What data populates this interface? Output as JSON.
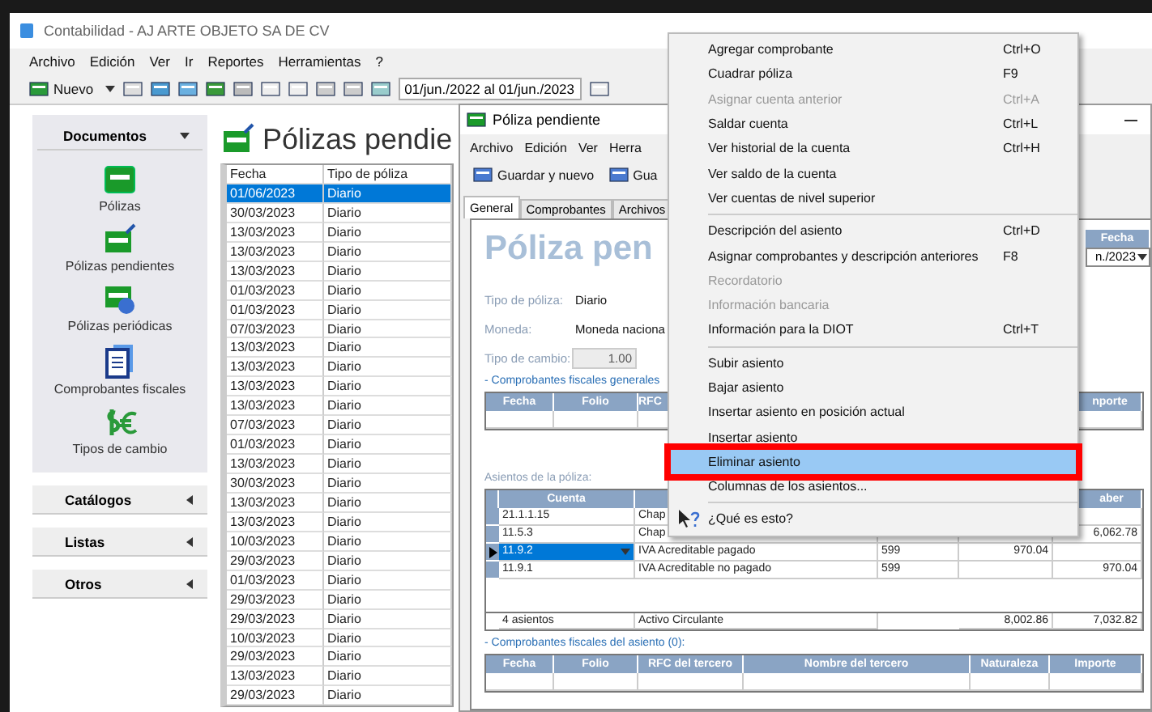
{
  "window": {
    "title": "Contabilidad - AJ ARTE OBJETO SA DE CV"
  },
  "menu_bar": [
    "Archivo",
    "Edición",
    "Ver",
    "Ir",
    "Reportes",
    "Herramientas",
    "?"
  ],
  "toolbar": {
    "new_button": "Nuevo",
    "date_range": "01/jun./2022 al 01/jun./2023"
  },
  "nav": {
    "header": "Documentos",
    "items": [
      {
        "label": "Pólizas",
        "kind": "polizas"
      },
      {
        "label": "Pólizas pendientes",
        "kind": "pendientes"
      },
      {
        "label": "Pólizas periódicas",
        "kind": "periodicas"
      },
      {
        "label": "Comprobantes fiscales",
        "kind": "comprobantes"
      },
      {
        "label": "Tipos de cambio",
        "kind": "cambio"
      }
    ],
    "sections": [
      "Catálogos",
      "Listas",
      "Otros"
    ]
  },
  "list": {
    "title": "Pólizas pendie",
    "columns": [
      "Fecha",
      "Tipo de póliza"
    ],
    "rows": [
      {
        "fecha": "01/06/2023",
        "tipo": "Diario",
        "selected": true
      },
      {
        "fecha": "30/03/2023",
        "tipo": "Diario",
        "selected": false
      },
      {
        "fecha": "13/03/2023",
        "tipo": "Diario",
        "selected": false
      },
      {
        "fecha": "13/03/2023",
        "tipo": "Diario",
        "selected": false
      },
      {
        "fecha": "13/03/2023",
        "tipo": "Diario",
        "selected": false
      },
      {
        "fecha": "01/03/2023",
        "tipo": "Diario",
        "selected": false
      },
      {
        "fecha": "01/03/2023",
        "tipo": "Diario",
        "selected": false
      },
      {
        "fecha": "07/03/2023",
        "tipo": "Diario",
        "selected": false
      },
      {
        "fecha": "13/03/2023",
        "tipo": "Diario",
        "selected": false
      },
      {
        "fecha": "13/03/2023",
        "tipo": "Diario",
        "selected": false
      },
      {
        "fecha": "13/03/2023",
        "tipo": "Diario",
        "selected": false
      },
      {
        "fecha": "13/03/2023",
        "tipo": "Diario",
        "selected": false
      },
      {
        "fecha": "07/03/2023",
        "tipo": "Diario",
        "selected": false
      },
      {
        "fecha": "01/03/2023",
        "tipo": "Diario",
        "selected": false
      },
      {
        "fecha": "13/03/2023",
        "tipo": "Diario",
        "selected": false
      },
      {
        "fecha": "30/03/2023",
        "tipo": "Diario",
        "selected": false
      },
      {
        "fecha": "13/03/2023",
        "tipo": "Diario",
        "selected": false
      },
      {
        "fecha": "13/03/2023",
        "tipo": "Diario",
        "selected": false
      },
      {
        "fecha": "10/03/2023",
        "tipo": "Diario",
        "selected": false
      },
      {
        "fecha": "29/03/2023",
        "tipo": "Diario",
        "selected": false
      },
      {
        "fecha": "01/03/2023",
        "tipo": "Diario",
        "selected": false
      },
      {
        "fecha": "29/03/2023",
        "tipo": "Diario",
        "selected": false
      },
      {
        "fecha": "29/03/2023",
        "tipo": "Diario",
        "selected": false
      },
      {
        "fecha": "10/03/2023",
        "tipo": "Diario",
        "selected": false
      },
      {
        "fecha": "29/03/2023",
        "tipo": "Diario",
        "selected": false
      },
      {
        "fecha": "13/03/2023",
        "tipo": "Diario",
        "selected": false
      },
      {
        "fecha": "29/03/2023",
        "tipo": "Diario",
        "selected": false
      }
    ]
  },
  "poliza_window": {
    "title": "Póliza pendiente",
    "menu_bar": [
      "Archivo",
      "Edición",
      "Ver",
      "Herra"
    ],
    "toolbar": [
      "Guardar y nuevo",
      "Gua"
    ],
    "tabs": [
      {
        "label": "General",
        "selected": true
      },
      {
        "label": "Comprobantes",
        "selected": false
      },
      {
        "label": "Archivos",
        "selected": false
      }
    ],
    "heading": "Póliza pen",
    "fields": [
      {
        "label": "Tipo de póliza:",
        "value": "Diario",
        "disabled": false
      },
      {
        "label": "Moneda:",
        "value": "Moneda naciona",
        "disabled": false
      },
      {
        "label": "Tipo de cambio:",
        "value": "1.00",
        "disabled": true
      }
    ],
    "date": {
      "label": "Fecha",
      "value": "n./2023"
    },
    "general_vouchers": {
      "title": "- Comprobantes fiscales generales",
      "columns": [
        "Fecha",
        "Folio",
        "RFC",
        null,
        null,
        "nporte"
      ]
    },
    "entries": {
      "title": "Asientos de la póliza:",
      "columns": [
        "Cuenta",
        null,
        null,
        null,
        "aber"
      ],
      "rows": [
        {
          "cuenta": "21.1.1.15",
          "concepto": "Chap",
          "ref": null,
          "debe": null,
          "haber": null,
          "selected": false
        },
        {
          "cuenta": "11.5.3",
          "concepto": "Chap",
          "ref": null,
          "debe": null,
          "haber": "6,062.78",
          "selected": false
        },
        {
          "cuenta": "11.9.2",
          "concepto": "IVA Acreditable pagado",
          "ref": "599",
          "debe": "970.04",
          "haber": null,
          "selected": true
        },
        {
          "cuenta": "11.9.1",
          "concepto": "IVA Acreditable no pagado",
          "ref": "599",
          "debe": null,
          "haber": "970.04",
          "selected": false
        }
      ],
      "totals": {
        "count": "4 asientos",
        "account": "Activo Circulante",
        "debe": "8,002.86",
        "haber": "7,032.82"
      }
    },
    "entry_vouchers": {
      "title": "- Comprobantes fiscales del asiento (0):",
      "columns": [
        "Fecha",
        "Folio",
        "RFC del tercero",
        "Nombre del tercero",
        "Naturaleza",
        "Importe"
      ]
    }
  },
  "context_menu": {
    "groups": [
      [
        {
          "label": "Agregar comprobante",
          "shortcut": "Ctrl+O",
          "disabled": false,
          "selected": false,
          "annotated": false
        },
        {
          "label": "Cuadrar póliza",
          "shortcut": "F9",
          "disabled": false,
          "selected": false,
          "annotated": false
        },
        {
          "label": "Asignar cuenta anterior",
          "shortcut": "Ctrl+A",
          "disabled": true,
          "selected": false,
          "annotated": false
        },
        {
          "label": "Saldar cuenta",
          "shortcut": "Ctrl+L",
          "disabled": false,
          "selected": false,
          "annotated": false
        },
        {
          "label": "Ver historial de la cuenta",
          "shortcut": "Ctrl+H",
          "disabled": false,
          "selected": false,
          "annotated": false
        },
        {
          "label": "Ver saldo de la cuenta",
          "disabled": false,
          "selected": false,
          "annotated": false
        },
        {
          "label": "Ver cuentas de nivel superior",
          "disabled": false,
          "selected": false,
          "annotated": false
        }
      ],
      [
        {
          "label": "Descripción del asiento",
          "shortcut": "Ctrl+D",
          "disabled": false,
          "selected": false,
          "annotated": false
        },
        {
          "label": "Asignar comprobantes y descripción anteriores",
          "shortcut": "F8",
          "disabled": false,
          "selected": false,
          "annotated": false
        },
        {
          "label": "Recordatorio",
          "disabled": true,
          "selected": false,
          "annotated": false
        },
        {
          "label": "Información bancaria",
          "disabled": true,
          "selected": false,
          "annotated": false
        },
        {
          "label": "Información para la DIOT",
          "shortcut": "Ctrl+T",
          "disabled": false,
          "selected": false,
          "annotated": false
        }
      ],
      [
        {
          "label": "Subir asiento",
          "disabled": false,
          "selected": false,
          "annotated": false
        },
        {
          "label": "Bajar asiento",
          "disabled": false,
          "selected": false,
          "annotated": false
        },
        {
          "label": "Insertar asiento en posición actual",
          "disabled": false,
          "selected": false,
          "annotated": false
        },
        {
          "label": "Insertar asiento",
          "disabled": false,
          "selected": false,
          "annotated": false
        },
        {
          "label": "Eliminar asiento",
          "disabled": false,
          "selected": true,
          "annotated": true
        },
        {
          "label": "Columnas de los asientos...",
          "disabled": false,
          "selected": false,
          "annotated": false
        }
      ],
      [
        {
          "label": "¿Qué es esto?",
          "disabled": false,
          "selected": false,
          "annotated": false,
          "kind": "help"
        }
      ]
    ]
  }
}
